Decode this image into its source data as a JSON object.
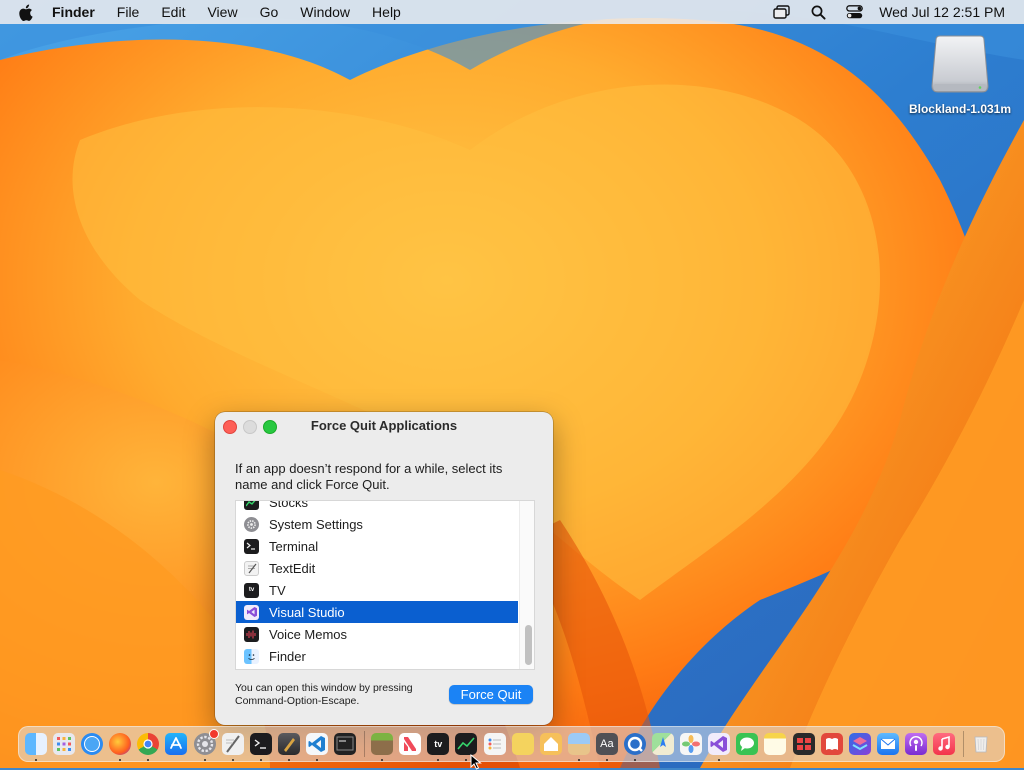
{
  "menubar": {
    "apple_icon": "apple-icon",
    "app_name": "Finder",
    "menus": [
      "File",
      "Edit",
      "View",
      "Go",
      "Window",
      "Help"
    ],
    "status_icons": [
      "screen-mirroring-icon",
      "search-icon",
      "control-center-icon"
    ],
    "clock": "Wed Jul 12  2:51 PM"
  },
  "desktop": {
    "drive": {
      "label": "Blockland-1.031m",
      "icon": "external-drive-icon"
    }
  },
  "force_quit": {
    "title": "Force Quit Applications",
    "instructions": "If an app doesn’t respond for a while, select its name and click Force Quit.",
    "apps": [
      {
        "name": "Stocks",
        "icon": "stocks-icon",
        "color": "#1c1c1e"
      },
      {
        "name": "System Settings",
        "icon": "gear-icon",
        "color": "#8e8e93"
      },
      {
        "name": "Terminal",
        "icon": "terminal-icon",
        "color": "#1c1c1e"
      },
      {
        "name": "TextEdit",
        "icon": "textedit-icon",
        "color": "#f2f2f2"
      },
      {
        "name": "TV",
        "icon": "tv-icon",
        "color": "#1c1c1e"
      },
      {
        "name": "Visual Studio",
        "icon": "visual-studio-icon",
        "color": "#8a4fd8",
        "selected": true
      },
      {
        "name": "Voice Memos",
        "icon": "voice-memos-icon",
        "color": "#1c1c1e"
      },
      {
        "name": "Finder",
        "icon": "finder-icon",
        "color": "#2d8cf0"
      }
    ],
    "footer_note": "You can open this window by pressing Command-Option-Escape.",
    "button_label": "Force Quit",
    "accent_color": "#0a5fd0"
  },
  "dock": {
    "apps": [
      {
        "name": "Finder",
        "icon": "finder-icon",
        "color": "#2e8ef5",
        "running": true
      },
      {
        "name": "Launchpad",
        "icon": "launchpad-icon",
        "color": "#e8e8ee"
      },
      {
        "name": "Safari",
        "icon": "safari-icon",
        "color": "#2a8bf2"
      },
      {
        "name": "Firefox",
        "icon": "firefox-icon",
        "color": "#ff7a1a",
        "running": true
      },
      {
        "name": "Chrome",
        "icon": "chrome-icon",
        "color": "#e9e9e9",
        "running": true
      },
      {
        "name": "App Store",
        "icon": "app-store-icon",
        "color": "#1d8bf3"
      },
      {
        "name": "System Settings",
        "icon": "gear-icon",
        "color": "#8e8e93",
        "running": true,
        "badge": true
      },
      {
        "name": "TextEdit",
        "icon": "textedit-icon",
        "color": "#f0f0f0",
        "running": true
      },
      {
        "name": "Terminal",
        "icon": "terminal-icon",
        "color": "#1c1c1e",
        "running": true
      },
      {
        "name": "Script",
        "icon": "script-icon",
        "color": "#3a3a3c",
        "running": true
      },
      {
        "name": "Visual Studio Code",
        "icon": "vscode-icon",
        "color": "#1f7fd1",
        "running": true
      },
      {
        "name": "Console",
        "icon": "console-icon",
        "color": "#222222"
      },
      {
        "name": "Minecraft",
        "icon": "minecraft-icon",
        "color": "#6b8f3a",
        "running": true
      },
      {
        "name": "News",
        "icon": "news-icon",
        "color": "#f04a5a"
      },
      {
        "name": "TV",
        "icon": "tv-icon",
        "color": "#1c1c1e",
        "running": true
      },
      {
        "name": "Stocks",
        "icon": "stocks-icon",
        "color": "#1c1c1e",
        "running": true
      },
      {
        "name": "Reminders",
        "icon": "reminders-icon",
        "color": "#f5f5f5"
      },
      {
        "name": "Stickies",
        "icon": "stickies-icon",
        "color": "#f4d35e"
      },
      {
        "name": "Home",
        "icon": "home-icon",
        "color": "#f6c05a"
      },
      {
        "name": "Preview",
        "icon": "preview-icon",
        "color": "#6aa8e8",
        "running": true
      },
      {
        "name": "Font Book",
        "icon": "font-book-icon",
        "color": "#505055",
        "running": true
      },
      {
        "name": "QuickTime",
        "icon": "quicktime-icon",
        "color": "#2a6fc9",
        "running": true
      },
      {
        "name": "Maps",
        "icon": "maps-icon",
        "color": "#58b55a"
      },
      {
        "name": "Photos",
        "icon": "photos-icon",
        "color": "#f6f6f6"
      },
      {
        "name": "Visual Studio",
        "icon": "visual-studio-icon",
        "color": "#8a4fd8",
        "running": true
      },
      {
        "name": "Messages",
        "icon": "messages-icon",
        "color": "#39c353"
      },
      {
        "name": "Notes",
        "icon": "notes-icon",
        "color": "#f7f0c8"
      },
      {
        "name": "Photo Booth",
        "icon": "photo-booth-icon",
        "color": "#2a2a2a"
      },
      {
        "name": "Books",
        "icon": "books-icon",
        "color": "#e2483c"
      },
      {
        "name": "Shortcuts",
        "icon": "shortcuts-icon",
        "color": "#6a4fd6"
      },
      {
        "name": "Mail",
        "icon": "mail-icon",
        "color": "#2d8cf0"
      },
      {
        "name": "Podcasts",
        "icon": "podcasts-icon",
        "color": "#9b43d8"
      },
      {
        "name": "Music",
        "icon": "music-icon",
        "color": "#f3445b"
      }
    ],
    "trash": {
      "name": "Trash",
      "icon": "trash-icon",
      "color": "#e7e9ec"
    }
  }
}
